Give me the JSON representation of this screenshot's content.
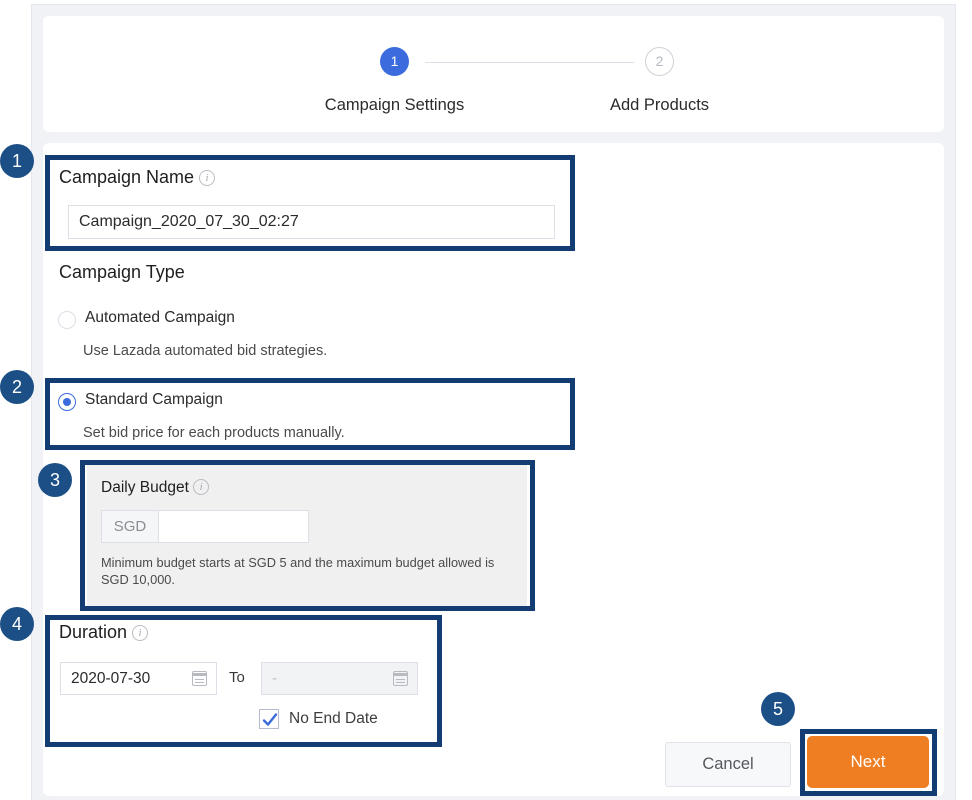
{
  "stepper": {
    "steps": [
      {
        "number": "1",
        "label": "Campaign Settings",
        "state": "active"
      },
      {
        "number": "2",
        "label": "Add Products",
        "state": "inactive"
      }
    ]
  },
  "form": {
    "campaign_name": {
      "title": "Campaign Name",
      "value": "Campaign_2020_07_30_02:27",
      "info_icon": "info-icon"
    },
    "campaign_type": {
      "title": "Campaign Type",
      "options": [
        {
          "label": "Automated Campaign",
          "description": "Use Lazada automated bid strategies.",
          "selected": false
        },
        {
          "label": "Standard Campaign",
          "description": "Set bid price for each products manually.",
          "selected": true
        }
      ]
    },
    "daily_budget": {
      "title": "Daily Budget",
      "currency": "SGD",
      "value": "",
      "help_text": "Minimum budget starts at SGD 5 and the maximum budget allowed is SGD 10,000."
    },
    "duration": {
      "title": "Duration",
      "start_date": "2020-07-30",
      "separator": "To",
      "end_date": "-",
      "no_end_date_label": "No End Date",
      "no_end_date_checked": true,
      "calendar_icon": "calendar-icon"
    }
  },
  "footer": {
    "cancel_label": "Cancel",
    "next_label": "Next"
  },
  "annotations": {
    "badges": [
      {
        "number": "1"
      },
      {
        "number": "2"
      },
      {
        "number": "3"
      },
      {
        "number": "4"
      },
      {
        "number": "5"
      }
    ]
  },
  "colors": {
    "step_active": "#3b6bdd",
    "annotation_navy": "#123c72",
    "badge_navy": "#1d4f87",
    "next_orange": "#ef7d22",
    "page_background": "#f0f2f5",
    "panel_gray": "#f0f0f0"
  }
}
